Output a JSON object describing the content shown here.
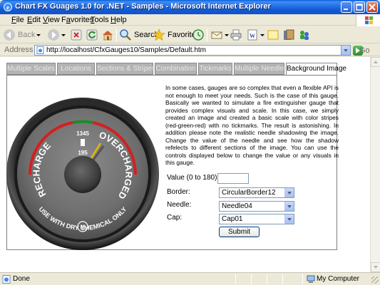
{
  "window": {
    "title": "Chart FX Guages 1.0 for .NET - Samples - Microsoft Internet Explorer"
  },
  "menu": [
    {
      "key": "F",
      "rest": "ile"
    },
    {
      "key": "E",
      "rest": "dit"
    },
    {
      "key": "V",
      "rest": "iew"
    },
    {
      "key": "",
      "pre": "F",
      "key2": "a",
      "rest": "vorites"
    },
    {
      "key": "T",
      "rest": "ools"
    },
    {
      "key": "H",
      "rest": "elp"
    }
  ],
  "toolbar": {
    "back_label": "Back",
    "search_label": "Search",
    "favorites_label": "Favorites"
  },
  "address": {
    "label": "Address",
    "url": "http://localhost/CfxGauges10/Samples/Default.htm",
    "go_label": "Go"
  },
  "tabs": [
    {
      "label": "Multiple Scales",
      "active": false
    },
    {
      "label": "Locations",
      "active": false
    },
    {
      "label": "Sections & Stripes",
      "active": false
    },
    {
      "label": "Combination",
      "active": false
    },
    {
      "label": "Tickmarks",
      "active": false
    },
    {
      "label": "Multiple Needles",
      "active": false
    },
    {
      "label": "Background Image",
      "active": true
    }
  ],
  "description": "In some cases, gauges are so complex that even a flexible API is not enough to meet your needs. Such is the case of this gauge. Basically we wanted to simulate a fire extinguisher gauge that provides complex visuals and scale. In this case, we simply created an image and created a basic scale with color stripes (red-green-red) with no tickmarks. The result is astonishing. In addition please note the realistic needle shadowing the image. Change the value of the needle and see how the shadow refelects to different sections of the image. You can use the controls displayed below to change the value or any visuals in this gauge.",
  "gauge": {
    "top_number": "1345",
    "bottom_number": "195",
    "left_text": "RECHARGE",
    "right_text": "OVERCHARGED",
    "bottom_text": "USE WITH DRY CHEMICAL ONLY",
    "logo": "M",
    "stripe_colors": [
      "#d42020",
      "#1e8a2a",
      "#d42020"
    ],
    "needle_color": "#e6b800"
  },
  "form": {
    "value_label": "Value (0 to 180):",
    "value": "",
    "border_label": "Border:",
    "border_value": "CircularBorder12",
    "needle_label": "Needle:",
    "needle_value": "Needle04",
    "cap_label": "Cap:",
    "cap_value": "Cap01",
    "submit_label": "Submit"
  },
  "status": {
    "left": "Done",
    "zone": "My Computer"
  }
}
